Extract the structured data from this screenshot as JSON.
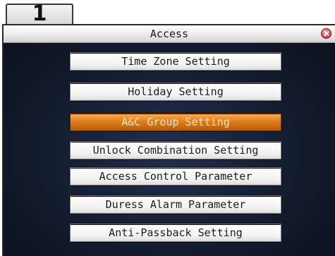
{
  "step_badge": "1",
  "window": {
    "title": "Access",
    "close_icon": "close-icon"
  },
  "menu": {
    "items": [
      {
        "label": "Time Zone Setting",
        "selected": false
      },
      {
        "label": "Holiday Setting",
        "selected": false
      },
      {
        "label": "A&C Group Setting",
        "selected": true
      },
      {
        "label": "Unlock Combination Setting",
        "selected": false
      },
      {
        "label": "Access Control Parameter",
        "selected": false
      },
      {
        "label": "Duress Alarm Parameter",
        "selected": false
      },
      {
        "label": "Anti-Passback Setting",
        "selected": false
      }
    ]
  },
  "colors": {
    "selected_item": "#e07f1e",
    "screen_background": "#131b2e",
    "close_button": "#e04848"
  }
}
